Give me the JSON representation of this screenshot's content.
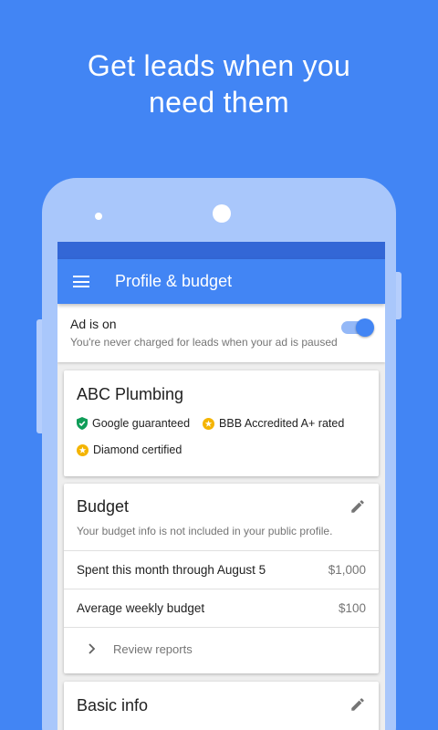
{
  "headline": {
    "line1": "Get leads when you",
    "line2": "need them"
  },
  "appbar": {
    "title": "Profile & budget",
    "menu_icon": "menu-icon"
  },
  "ad_status": {
    "title": "Ad is on",
    "subtitle": "You're never charged for leads when your ad is paused",
    "toggle_on": true
  },
  "business": {
    "name": "ABC Plumbing",
    "badges": [
      {
        "label": "Google guaranteed",
        "icon": "shield-check-icon",
        "color": "#0f9d58"
      },
      {
        "label": "BBB Accredited A+ rated",
        "icon": "star-badge-icon",
        "color": "#f4b400"
      },
      {
        "label": "Diamond certified",
        "icon": "star-badge-icon",
        "color": "#f4b400"
      }
    ]
  },
  "budget": {
    "title": "Budget",
    "note": "Your budget info is not included in your public profile.",
    "rows": [
      {
        "label": "Spent this month through August 5",
        "value": "$1,000"
      },
      {
        "label": "Average weekly budget",
        "value": "$100"
      }
    ],
    "review_label": "Review reports"
  },
  "basic_info": {
    "title": "Basic info"
  },
  "colors": {
    "background": "#4285f4",
    "appbar": "#4285f4",
    "statusbar": "#3367d6",
    "phone_body": "#a9c7fb"
  }
}
